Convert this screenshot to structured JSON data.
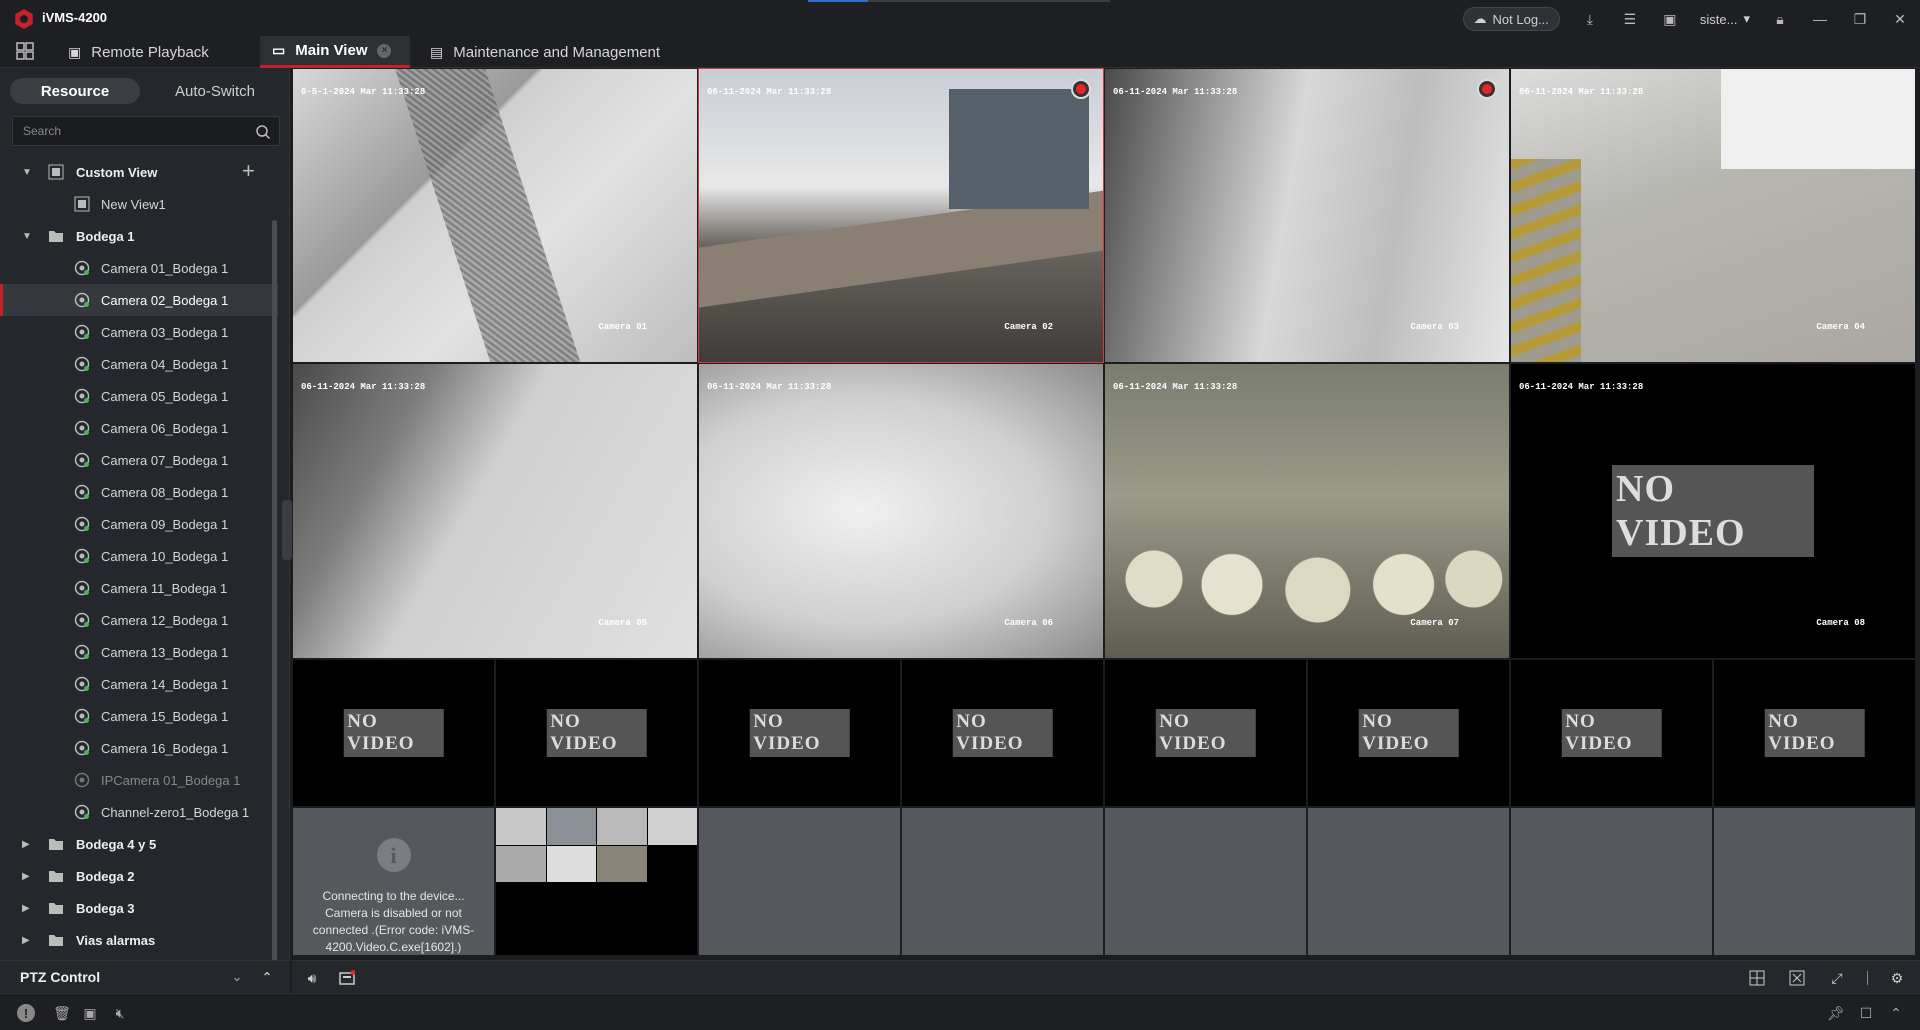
{
  "app": {
    "title": "iVMS-4200",
    "brand_color": "#c8202a"
  },
  "titlebar": {
    "login_label": "Not Log...",
    "user_label": "siste..."
  },
  "tabs": [
    {
      "label": "Remote Playback"
    },
    {
      "label": "Main View"
    },
    {
      "label": "Maintenance and Management"
    }
  ],
  "sidebar": {
    "subtabs": [
      "Resource",
      "Auto-Switch"
    ],
    "search_placeholder": "Search",
    "tree": [
      {
        "label": "Custom View"
      },
      {
        "label": "New View1"
      },
      {
        "label": "Bodega 1"
      },
      {
        "label": "Camera 01_Bodega 1"
      },
      {
        "label": "Camera 02_Bodega 1"
      },
      {
        "label": "Camera 03_Bodega 1"
      },
      {
        "label": "Camera 04_Bodega 1"
      },
      {
        "label": "Camera 05_Bodega 1"
      },
      {
        "label": "Camera 06_Bodega 1"
      },
      {
        "label": "Camera 07_Bodega 1"
      },
      {
        "label": "Camera 08_Bodega 1"
      },
      {
        "label": "Camera 09_Bodega 1"
      },
      {
        "label": "Camera 10_Bodega 1"
      },
      {
        "label": "Camera 11_Bodega 1"
      },
      {
        "label": "Camera 12_Bodega 1"
      },
      {
        "label": "Camera 13_Bodega 1"
      },
      {
        "label": "Camera 14_Bodega 1"
      },
      {
        "label": "Camera 15_Bodega 1"
      },
      {
        "label": "Camera 16_Bodega 1"
      },
      {
        "label": "IPCamera 01_Bodega 1"
      },
      {
        "label": "Channel-zero1_Bodega 1"
      },
      {
        "label": "Bodega 4 y 5"
      },
      {
        "label": "Bodega 2"
      },
      {
        "label": "Bodega 3"
      },
      {
        "label": "Vias alarmas"
      }
    ],
    "ptz_label": "PTZ Control"
  },
  "video": {
    "timestamp": "06-11-2024 Mar 11:33:28",
    "timestamp_cam1": "0-5-1-2024 Mar 11:33:28",
    "cam_labels": [
      "Camera 01",
      "Camera 02",
      "Camera 03",
      "Camera 04",
      "Camera 05",
      "Camera 06",
      "Camera 07",
      "Camera 08"
    ],
    "no_video": "NO VIDEO",
    "connecting_msg": "Connecting to the device... Camera is disabled or not connected .(Error code: iVMS-4200.Video.C.exe[1602].)"
  }
}
